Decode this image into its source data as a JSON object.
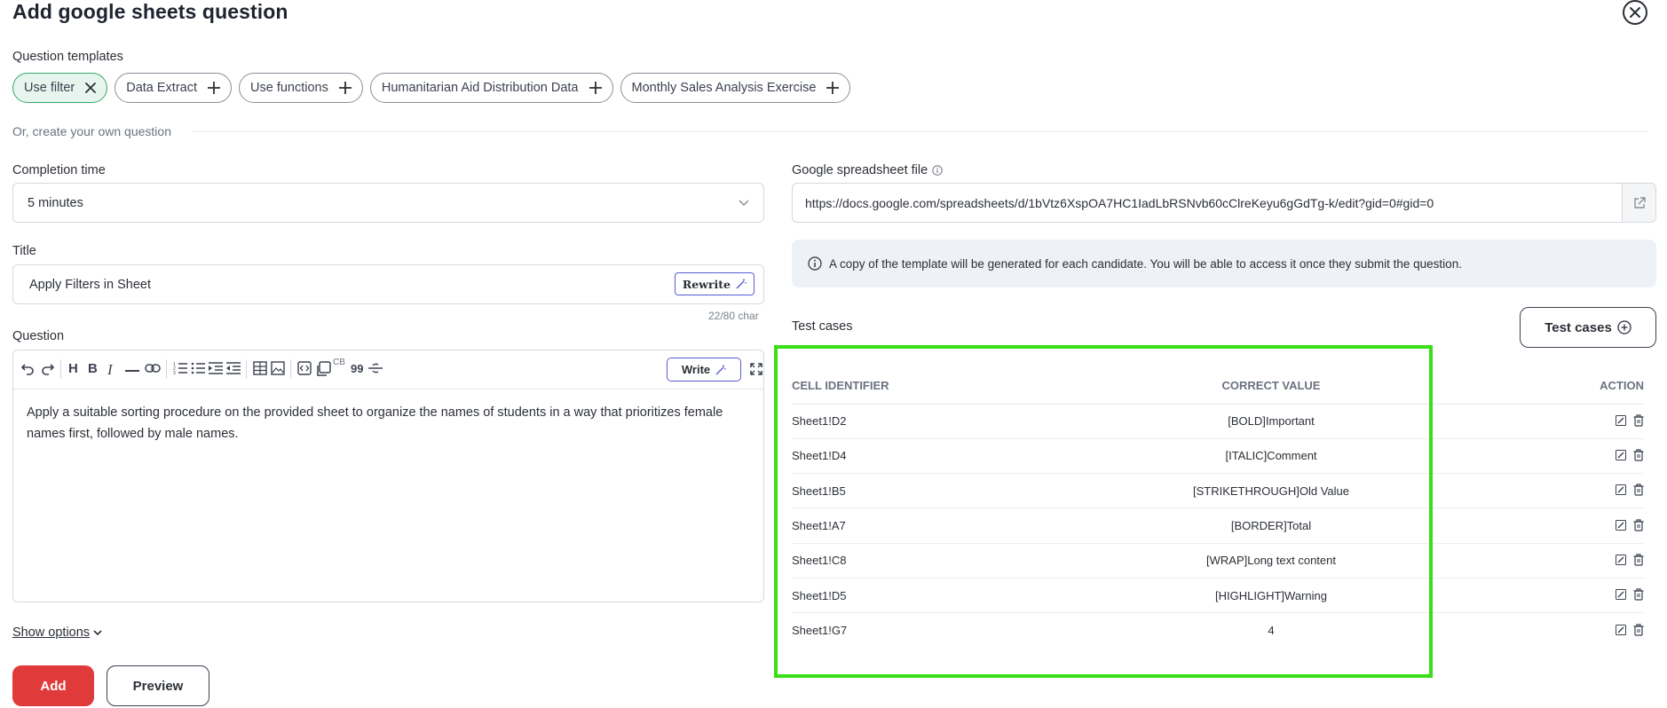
{
  "header": {
    "title": "Add google sheets question"
  },
  "templates": {
    "label": "Question templates",
    "chips": [
      {
        "label": "Use filter",
        "active": true
      },
      {
        "label": "Data Extract",
        "active": false
      },
      {
        "label": "Use functions",
        "active": false
      },
      {
        "label": "Humanitarian Aid Distribution Data",
        "active": false
      },
      {
        "label": "Monthly Sales Analysis Exercise",
        "active": false
      }
    ],
    "own_question": "Or, create your own question"
  },
  "completion": {
    "label": "Completion time",
    "value": "5 minutes"
  },
  "title_field": {
    "label": "Title",
    "value": "Apply Filters in Sheet",
    "rewrite": "Rewrite",
    "char_count": "22/80 char"
  },
  "question": {
    "label": "Question",
    "write": "Write",
    "body": "Apply a suitable sorting procedure on the provided sheet to organize the names of students in a way that prioritizes female names first, followed by male names.",
    "cb_label": "CB",
    "quote_label": "99"
  },
  "show_options": "Show options",
  "buttons": {
    "add": "Add",
    "preview": "Preview"
  },
  "spreadsheet": {
    "label": "Google spreadsheet file",
    "url": "https://docs.google.com/spreadsheets/d/1bVtz6XspOA7HC1IadLbRSNvb60cClreKeyu6gGdTg-k/edit?gid=0#gid=0",
    "info": "A copy of the template will be generated for each candidate. You will be able to access it once they submit the question."
  },
  "test_cases": {
    "label": "Test cases",
    "button": "Test cases",
    "columns": [
      "CELL IDENTIFIER",
      "CORRECT VALUE",
      "ACTION"
    ],
    "rows": [
      {
        "cell": "Sheet1!D2",
        "value": "[BOLD]Important"
      },
      {
        "cell": "Sheet1!D4",
        "value": "[ITALIC]Comment"
      },
      {
        "cell": "Sheet1!B5",
        "value": "[STRIKETHROUGH]Old Value"
      },
      {
        "cell": "Sheet1!A7",
        "value": "[BORDER]Total"
      },
      {
        "cell": "Sheet1!C8",
        "value": "[WRAP]Long text content"
      },
      {
        "cell": "Sheet1!D5",
        "value": "[HIGHLIGHT]Warning"
      },
      {
        "cell": "Sheet1!G7",
        "value": "4"
      }
    ]
  },
  "colors": {
    "primary_red": "#e03a3a",
    "highlight_green": "#3adf19",
    "chip_active_bg": "#e6f6ee",
    "accent_purple": "#5b5bd6"
  }
}
